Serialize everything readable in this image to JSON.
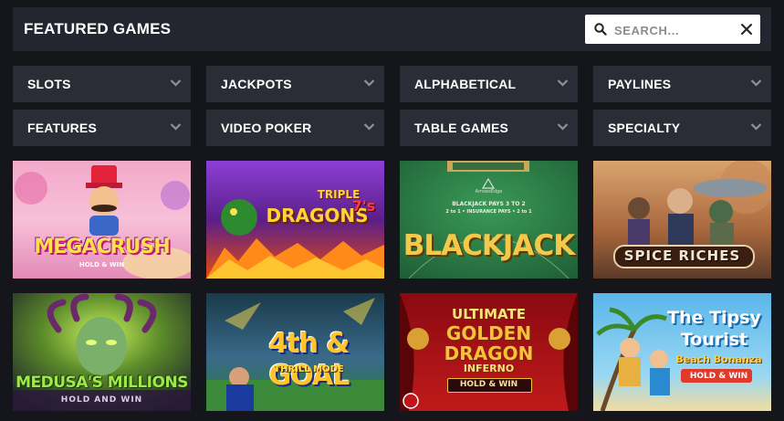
{
  "header": {
    "title": "FEATURED GAMES",
    "search_placeholder": "SEARCH...",
    "search_icon": "search-icon",
    "close_icon": "close-icon"
  },
  "filters": [
    {
      "label": "SLOTS"
    },
    {
      "label": "JACKPOTS"
    },
    {
      "label": "ALPHABETICAL"
    },
    {
      "label": "PAYLINES"
    },
    {
      "label": "FEATURES"
    },
    {
      "label": "VIDEO POKER"
    },
    {
      "label": "TABLE GAMES"
    },
    {
      "label": "SPECIALTY"
    }
  ],
  "games": [
    {
      "title": "MEGACRUSH",
      "subtitle": "HOLD & WIN"
    },
    {
      "title_line1": "TRIPLE",
      "title_line2": "DRAGONS",
      "title_suffix": "7's"
    },
    {
      "title": "BLACKJACK",
      "table_text_1": "BLACKJACK PAYS 3 TO 2",
      "table_text_2": "2 to 1 • INSURANCE PAYS • 2 to 1",
      "brand": "ArrowsEdge"
    },
    {
      "title": "SPICE RICHES"
    },
    {
      "title": "MEDUSA'S MILLIONS",
      "subtitle": "HOLD AND WIN"
    },
    {
      "title": "4th & GOAL",
      "subtitle": "THRILL MODE"
    },
    {
      "title_line1": "ULTIMATE",
      "title_line2": "GOLDEN",
      "title_line3": "DRAGON",
      "title_line4": "INFERNO",
      "subtitle": "HOLD & WIN"
    },
    {
      "title_line1": "The Tipsy",
      "title_line2": "Tourist",
      "title_line3": "Beach Bonanza",
      "subtitle": "HOLD & WIN"
    }
  ],
  "colors": {
    "page_bg": "#14161b",
    "header_bg": "#23262f",
    "filter_bg": "#2a2d36",
    "text": "#ffffff"
  }
}
